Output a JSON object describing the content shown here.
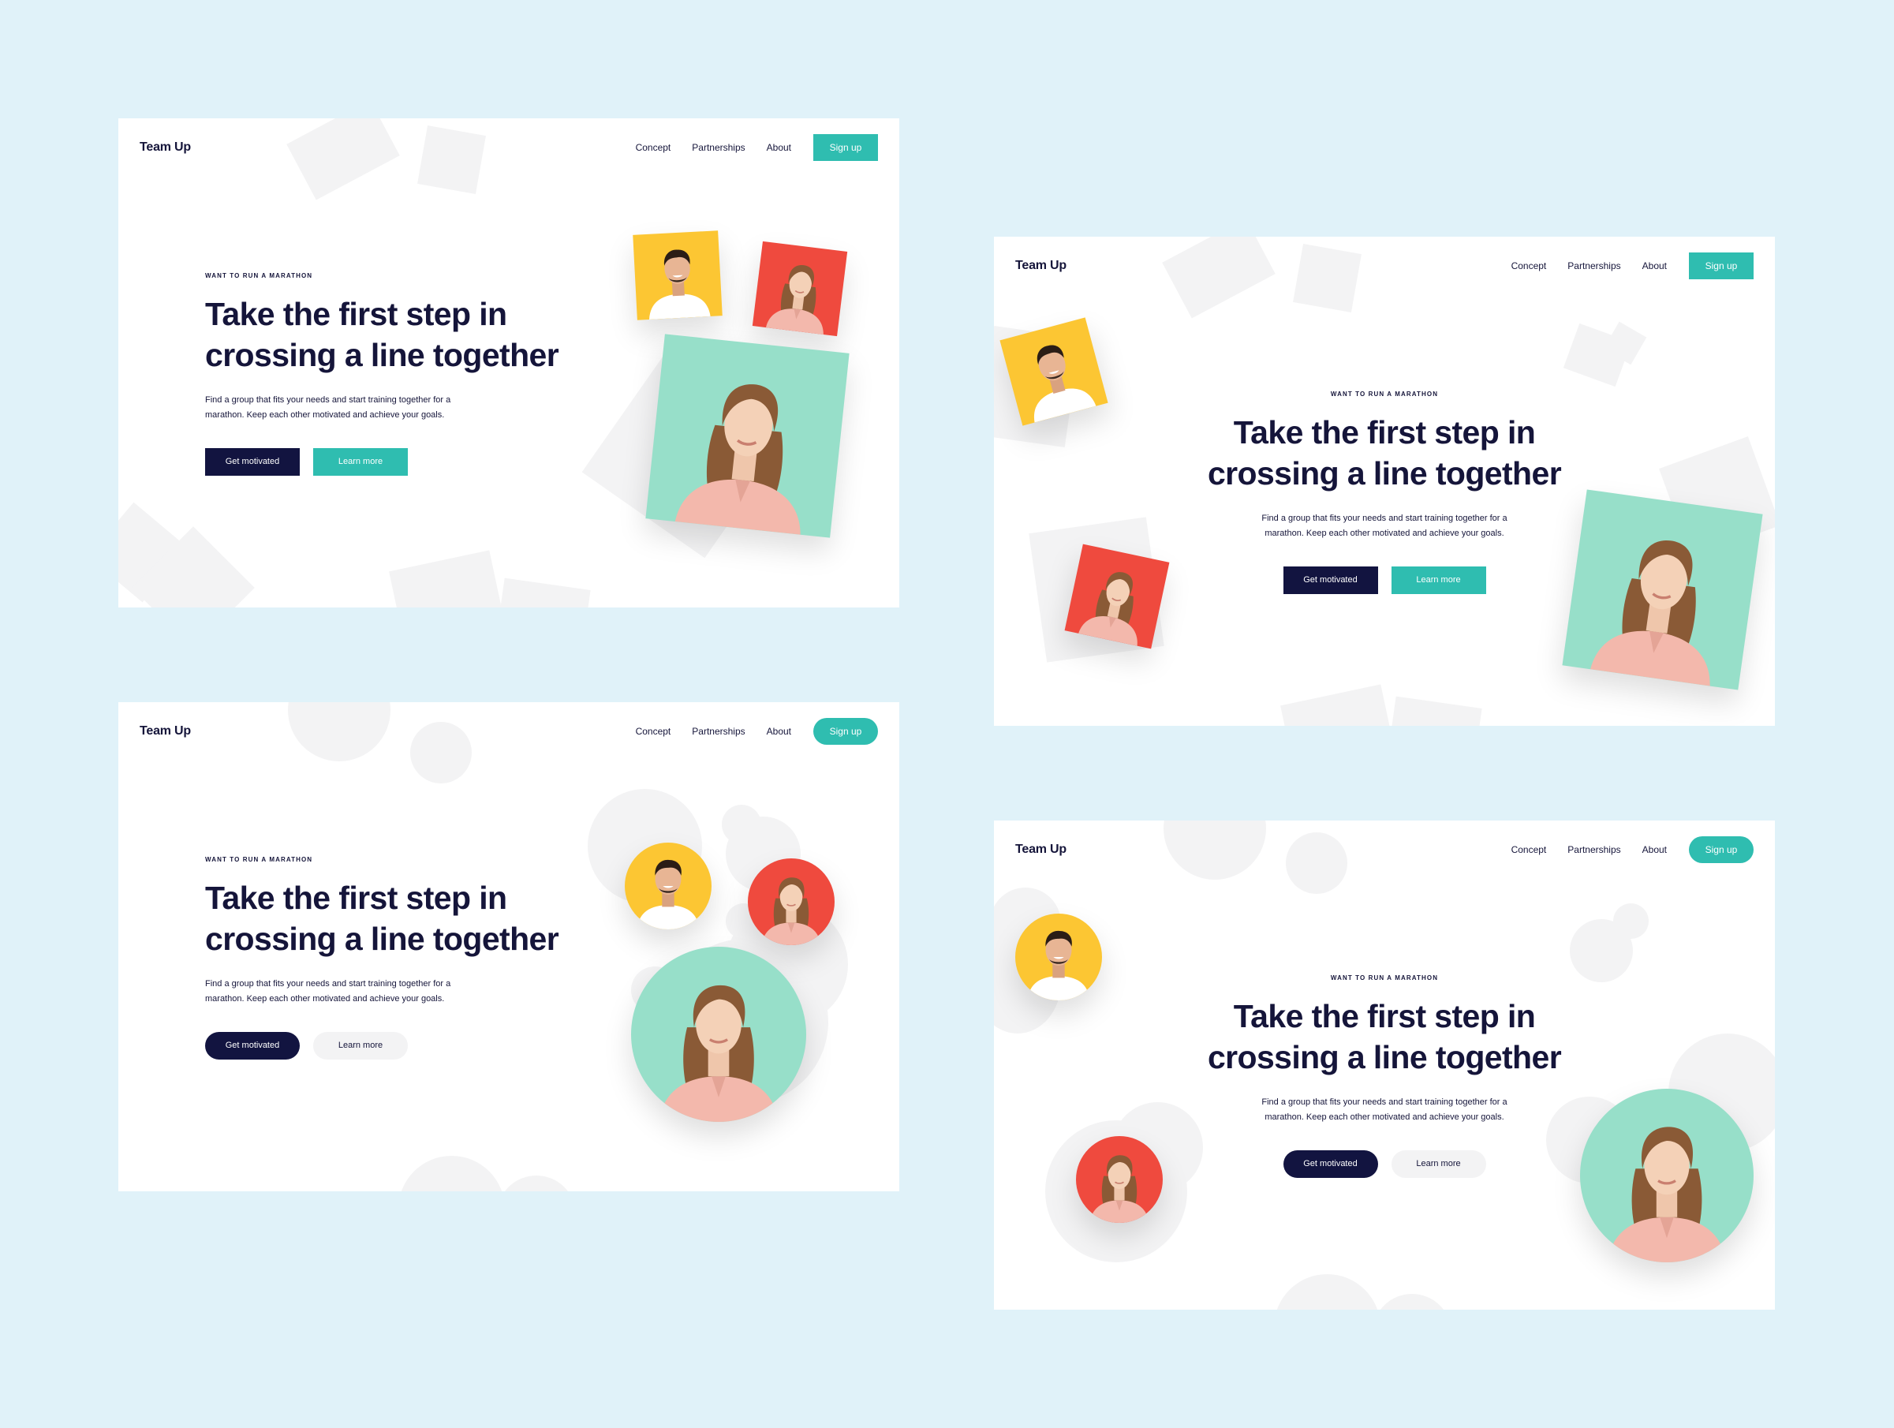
{
  "colors": {
    "page_background": "#e0f2f9",
    "card_background": "#ffffff",
    "navy": "#121440",
    "teal": "#2fbdb0",
    "yellow": "#fcc633",
    "red": "#ef4a3e",
    "mint": "#97dfc9",
    "decor_grey": "#f3f3f4"
  },
  "brand": "Team Up",
  "nav": {
    "concept": "Concept",
    "partnerships": "Partnerships",
    "about": "About",
    "signup": "Sign up"
  },
  "hero": {
    "eyebrow": "WANT TO RUN A MARATHON",
    "title_line1": "Take the first  step in",
    "title_line2": "crossing a line together",
    "desc_line1": "Find a group that fits your needs and start training together for a",
    "desc_line2": "marathon. Keep each other motivated and achieve your goals."
  },
  "buttons": {
    "primary": "Get motivated",
    "secondary": "Learn more"
  },
  "variants": [
    {
      "layout": "left-aligned",
      "shape": "square",
      "secondary_style": "teal"
    },
    {
      "layout": "centered",
      "shape": "square",
      "secondary_style": "teal"
    },
    {
      "layout": "left-aligned",
      "shape": "round",
      "secondary_style": "light"
    },
    {
      "layout": "centered",
      "shape": "round",
      "secondary_style": "light"
    }
  ],
  "icons": [
    "man-portrait-icon",
    "woman-portrait-icon"
  ]
}
